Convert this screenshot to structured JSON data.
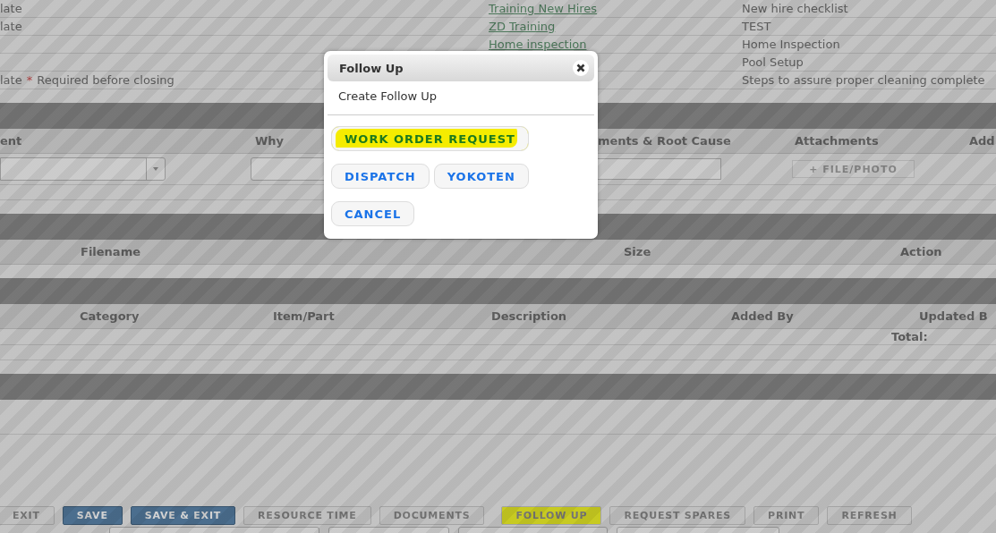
{
  "records": [
    {
      "template": "late",
      "link": "Training New Hires",
      "description": "New hire checklist"
    },
    {
      "template": "late",
      "link": "ZD Training",
      "description": "TEST"
    },
    {
      "link": "Home inspection",
      "description": "Home Inspection"
    },
    {
      "description": "Pool Setup"
    },
    {
      "template": "late",
      "required_mark": "*",
      "required_note": "Required before closing",
      "description": "Steps to assure proper cleaning complete"
    }
  ],
  "root_cause": {
    "columns": [
      "ent",
      "Why",
      "ments & Root Cause",
      "Attachments",
      "Add"
    ],
    "file_button": {
      "label": "+ FILE/PHOTO",
      "disabled": true
    }
  },
  "attachments": {
    "columns": [
      "Filename",
      "Size",
      "Action"
    ]
  },
  "parts": {
    "columns": [
      "Category",
      "Item/Part",
      "Description",
      "Added By",
      "Updated B"
    ],
    "total_label": "Total:"
  },
  "buttons": [
    {
      "label": "EXIT",
      "kind": "default",
      "highlighted": false
    },
    {
      "label": "SAVE",
      "kind": "primary",
      "highlighted": false
    },
    {
      "label": "SAVE & EXIT",
      "kind": "primary",
      "highlighted": false
    },
    {
      "label": "RESOURCE TIME",
      "kind": "default",
      "highlighted": false
    },
    {
      "label": "DOCUMENTS",
      "kind": "default",
      "highlighted": false
    },
    {
      "label": "FOLLOW UP",
      "kind": "default",
      "highlighted": true
    },
    {
      "label": "REQUEST SPARES",
      "kind": "default",
      "highlighted": false
    },
    {
      "label": "PRINT",
      "kind": "default",
      "highlighted": false
    },
    {
      "label": "REFRESH",
      "kind": "default",
      "highlighted": false
    }
  ],
  "dialog": {
    "title": "Follow Up",
    "subtitle": "Create Follow Up",
    "actions": [
      {
        "label": "WORK ORDER REQUEST",
        "highlighted": true
      },
      {
        "label": "DISPATCH",
        "highlighted": false
      },
      {
        "label": "YOKOTEN",
        "highlighted": false
      },
      {
        "label": "CANCEL",
        "highlighted": false
      }
    ]
  }
}
